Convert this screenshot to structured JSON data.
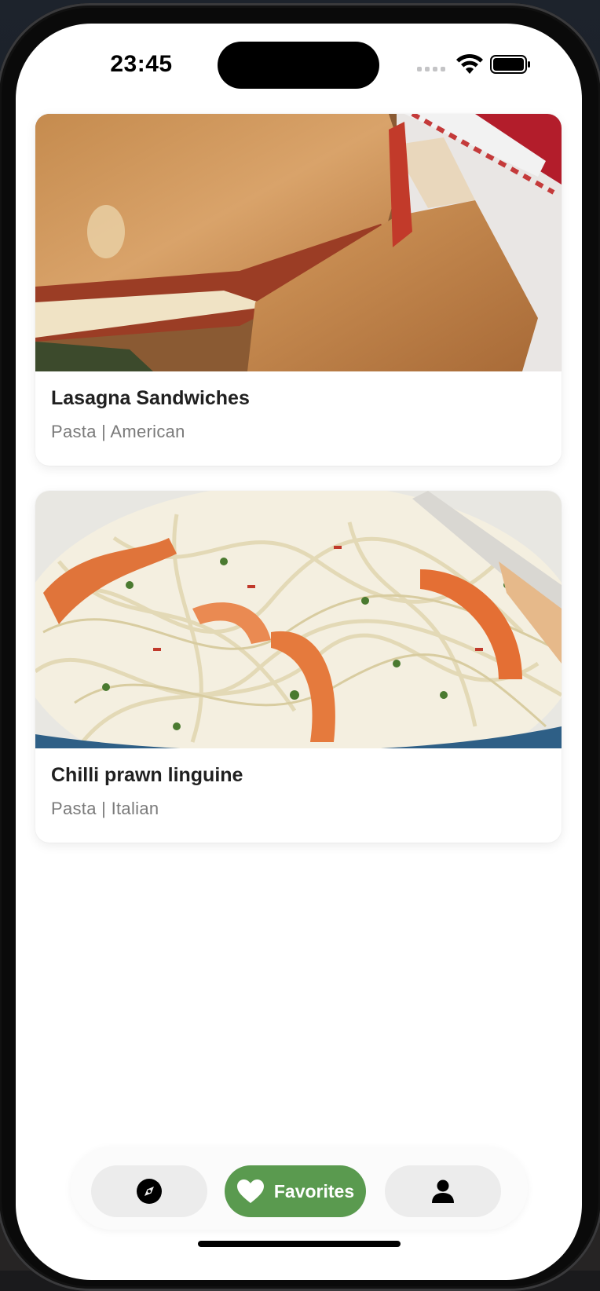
{
  "status_bar": {
    "time": "23:45"
  },
  "recipes": [
    {
      "title": "Lasagna Sandwiches",
      "subtitle": "Pasta | American"
    },
    {
      "title": "Chilli prawn linguine",
      "subtitle": "Pasta | Italian"
    }
  ],
  "bottom_nav": {
    "items": [
      {
        "icon": "compass-icon",
        "label": ""
      },
      {
        "icon": "heart-icon",
        "label": "Favorites"
      },
      {
        "icon": "person-icon",
        "label": ""
      }
    ],
    "active_color": "#5a9a4f",
    "inactive_bg": "#ececec"
  }
}
